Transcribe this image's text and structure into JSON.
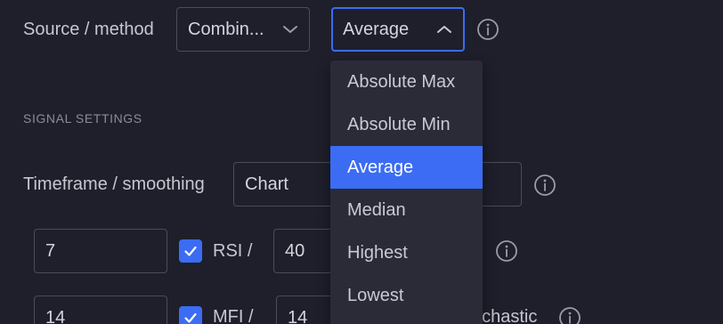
{
  "source_row": {
    "label": "Source / method",
    "source_value": "Combin...",
    "method_value": "Average"
  },
  "signal_settings": {
    "title": "SIGNAL SETTINGS",
    "timeframe_label": "Timeframe / smoothing",
    "timeframe_value": "Chart",
    "rows": [
      {
        "length": "7",
        "checked": true,
        "indicator": "RSI /",
        "value": "40",
        "extra": ""
      },
      {
        "length": "14",
        "checked": true,
        "indicator": "MFI /",
        "value": "14",
        "extra": "ochastic"
      }
    ]
  },
  "dropdown": {
    "options": [
      "Absolute Max",
      "Absolute Min",
      "Average",
      "Median",
      "Highest",
      "Lowest"
    ],
    "selected": "Average"
  },
  "colors": {
    "background": "#1e1f2b",
    "accent": "#3b6cf3",
    "dropdown_bg": "#2a2b37",
    "border": "#4a4c59"
  },
  "icons": [
    "chevron-down-icon",
    "chevron-up-icon",
    "info-icon",
    "checkmark-icon"
  ]
}
